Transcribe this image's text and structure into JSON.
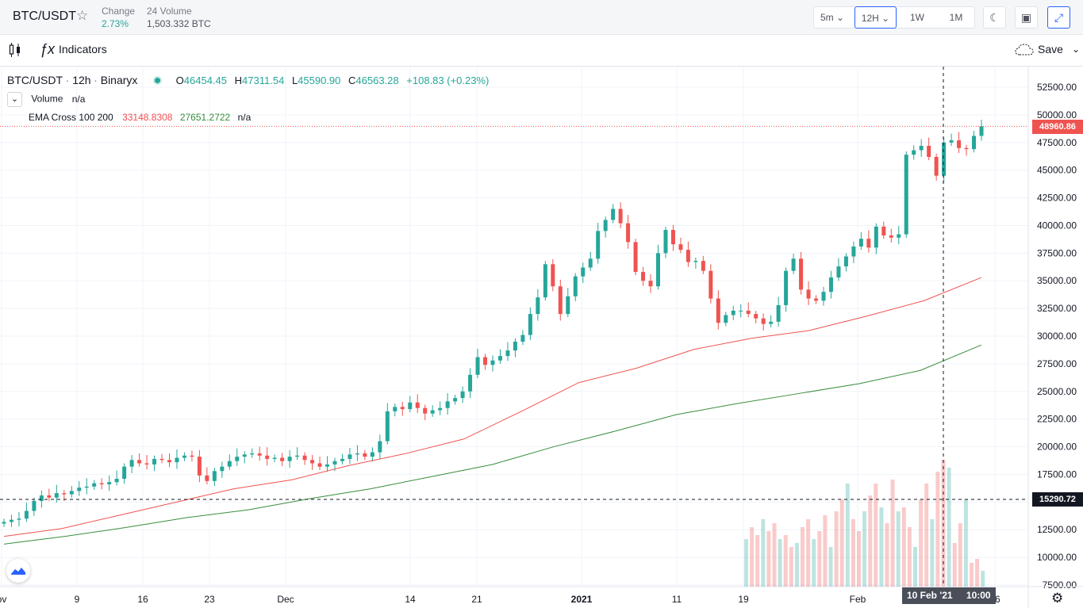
{
  "header": {
    "symbol": "BTC/USDT",
    "change_label": "Change",
    "change_value": "2.73%",
    "volume_label": "24 Volume",
    "volume_value": "1,503.332 BTC",
    "timeframes": [
      "5m",
      "12H",
      "1W",
      "1M"
    ],
    "active_timeframe": "12H"
  },
  "toolbar": {
    "indicators_label": "Indicators",
    "save_label": "Save"
  },
  "legend": {
    "symbol": "BTC/USDT",
    "interval": "12h",
    "exchange": "Binaryx",
    "open_key": "O",
    "open": "46454.45",
    "high_key": "H",
    "high": "47311.54",
    "low_key": "L",
    "low": "45590.90",
    "close_key": "C",
    "close": "46563.28",
    "change": "+108.83 (+0.23%)",
    "volume_label": "Volume",
    "volume_value": "n/a",
    "ema_label": "EMA Cross 100 200",
    "ema100": "33148.8308",
    "ema200": "27651.2722",
    "ema_na": "n/a"
  },
  "price_axis": {
    "ticks": [
      "52500.00",
      "50000.00",
      "47500.00",
      "45000.00",
      "42500.00",
      "40000.00",
      "37500.00",
      "35000.00",
      "32500.00",
      "30000.00",
      "27500.00",
      "25000.00",
      "22500.00",
      "20000.00",
      "17500.00",
      "15000.00",
      "12500.00",
      "10000.00",
      "7500.00"
    ],
    "last_price": "48960.86",
    "crosshair_price": "15290.72"
  },
  "time_axis": {
    "labels": [
      "ov",
      "9",
      "16",
      "23",
      "Dec",
      "14",
      "21",
      "2021",
      "11",
      "19",
      "Feb",
      "16"
    ],
    "crosshair_date": "10 Feb '21",
    "crosshair_time": "10:00"
  },
  "colors": {
    "up": "#26a69a",
    "down": "#ef5350",
    "ema100": "#ef5350",
    "ema200": "#388e3c",
    "accent": "#2962ff"
  },
  "chart_data": {
    "type": "candlestick",
    "interval": "12h",
    "ylim": [
      7500,
      52500
    ],
    "candles_close_approx": [
      13200,
      13400,
      13500,
      14200,
      15100,
      15600,
      15400,
      15800,
      15700,
      16000,
      16300,
      16400,
      16700,
      16600,
      16800,
      17100,
      18200,
      18800,
      18500,
      18400,
      18900,
      18800,
      18600,
      19000,
      19200,
      19100,
      17400,
      16900,
      17800,
      18200,
      18700,
      19100,
      19300,
      19400,
      19200,
      18900,
      19000,
      18700,
      19100,
      19200,
      18800,
      18500,
      18200,
      18400,
      18700,
      18900,
      19300,
      19400,
      19100,
      19500,
      20500,
      23200,
      23600,
      23400,
      24000,
      23500,
      23000,
      23300,
      23500,
      24100,
      24400,
      25000,
      26500,
      28100,
      27400,
      27800,
      28200,
      28700,
      29500,
      30100,
      32000,
      33500,
      36500,
      34500,
      32000,
      33600,
      35400,
      36200,
      37000,
      39500,
      40500,
      41500,
      40200,
      38500,
      35800,
      35000,
      34500,
      37500,
      39600,
      38300,
      37800,
      36700,
      36800,
      35900,
      33400,
      31200,
      31900,
      32300,
      32300,
      32000,
      31600,
      31100,
      31300,
      32800,
      35900,
      37000,
      34200,
      33400,
      33200,
      34000,
      35300,
      36300,
      37200,
      38100,
      38800,
      38000,
      39900,
      39100,
      38900,
      39200,
      46400,
      46800,
      47200,
      46200,
      44500,
      47500,
      47700,
      47000,
      46900,
      48100,
      48960
    ],
    "ema100_approx": [
      11900,
      12600,
      13800,
      15000,
      16200,
      17000,
      18300,
      19400,
      20700,
      23200,
      25800,
      27100,
      28800,
      29800,
      30500,
      31800,
      33200,
      35300
    ],
    "ema200_approx": [
      11200,
      11900,
      12700,
      13600,
      14300,
      15300,
      16200,
      17300,
      18400,
      20000,
      21400,
      22900,
      23900,
      24800,
      25700,
      26900,
      29200
    ]
  }
}
